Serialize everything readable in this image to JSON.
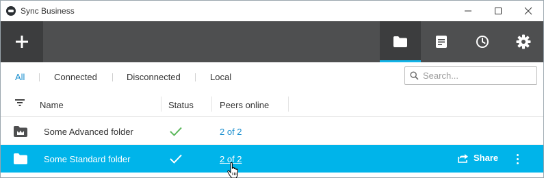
{
  "window": {
    "title": "Sync Business",
    "controls": [
      "minimize",
      "maximize",
      "close"
    ]
  },
  "toolbar": {
    "add_icon": "plus-icon",
    "tools": [
      {
        "icon": "folder-icon",
        "active": true
      },
      {
        "icon": "document-icon",
        "active": false
      },
      {
        "icon": "clock-icon",
        "active": false
      },
      {
        "icon": "gear-icon",
        "active": false
      }
    ],
    "accent_color": "#12b4e8",
    "background": "#4e4f50"
  },
  "filters": {
    "tabs": [
      "All",
      "Connected",
      "Disconnected",
      "Local"
    ],
    "active": "All"
  },
  "search": {
    "placeholder": "Search...",
    "value": ""
  },
  "table": {
    "columns": [
      "Name",
      "Status",
      "Peers online"
    ],
    "rows": [
      {
        "icon": "advanced-folder-icon",
        "name": "Some Advanced folder",
        "status": "check",
        "peers": "2 of 2",
        "selected": false
      },
      {
        "icon": "folder-icon",
        "name": "Some Standard folder",
        "status": "check",
        "peers": "2 of 2",
        "selected": true
      }
    ],
    "row_actions": {
      "share_label": "Share"
    },
    "selected_color": "#00b4ea",
    "status_ok_color": "#5cb85c"
  }
}
